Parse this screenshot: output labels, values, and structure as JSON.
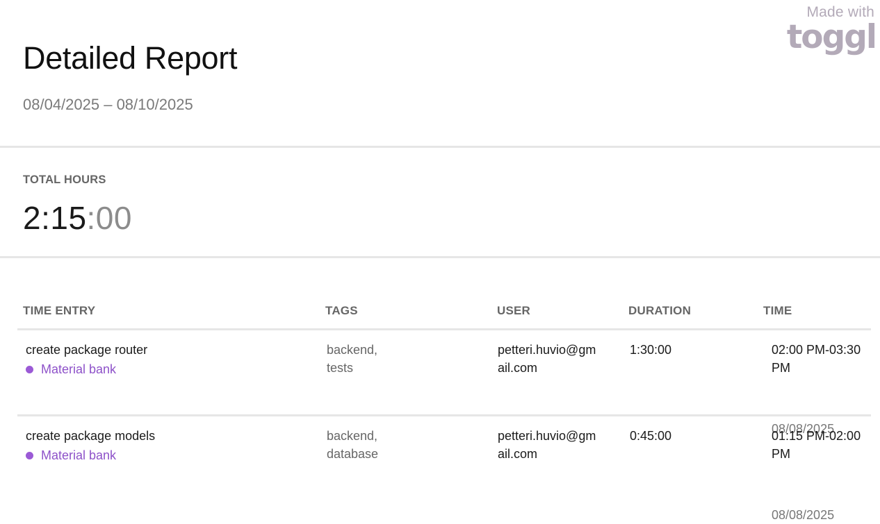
{
  "report": {
    "title": "Detailed Report",
    "date_range": "08/04/2025 – 08/10/2025"
  },
  "brand": {
    "made_with": "Made with",
    "logo_text": "toggl"
  },
  "totals": {
    "label": "TOTAL HOURS",
    "hours_minutes": "2:15",
    "seconds": ":00"
  },
  "table": {
    "headers": {
      "time_entry": "TIME ENTRY",
      "tags": "TAGS",
      "user": "USER",
      "duration": "DURATION",
      "time": "TIME"
    },
    "rows": [
      {
        "description": "create package router",
        "project": "Material bank",
        "tags": "backend, tests",
        "user": "petteri.huvio@gmail.com",
        "duration": "1:30:00",
        "time_range": "02:00 PM-03:30 PM",
        "date": "08/08/2025"
      },
      {
        "description": "create package models",
        "project": "Material bank",
        "tags": "backend, database",
        "user": "petteri.huvio@gmail.com",
        "duration": "0:45:00",
        "time_range": "01:15 PM-02:00 PM",
        "date": "08/08/2025"
      }
    ]
  },
  "colors": {
    "project": "#8e52c9",
    "project_dot": "#9b5ad6",
    "brand": "#b3aab8",
    "divider": "#e6e6e6"
  }
}
